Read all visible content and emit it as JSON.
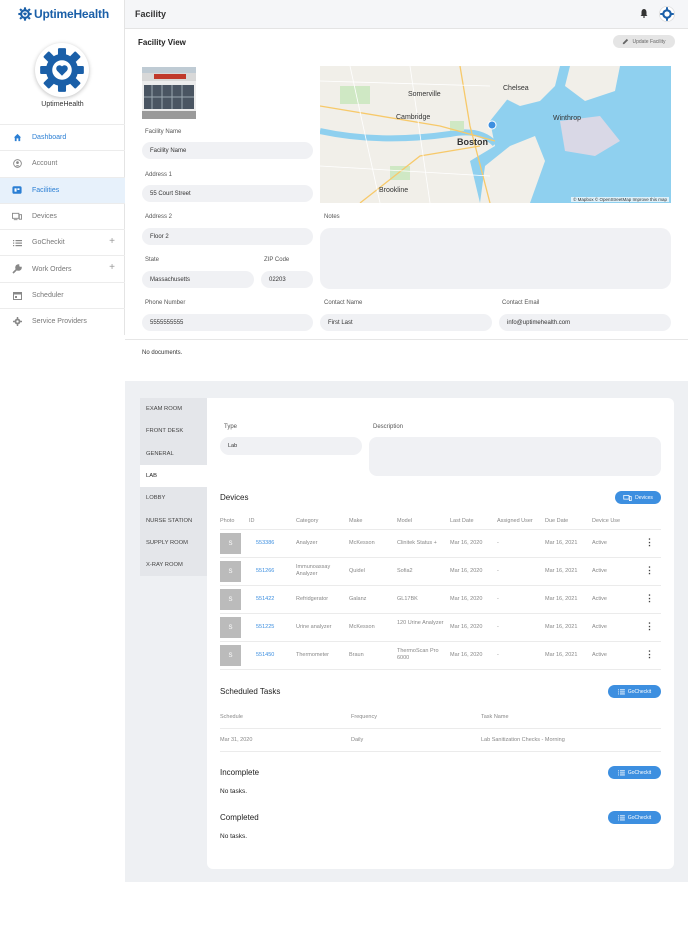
{
  "app": {
    "brand": "UptimeHealth",
    "org_name": "UptimeHealth"
  },
  "sidebar": {
    "items": [
      {
        "label": "Dashboard",
        "icon": "home-icon",
        "active": false
      },
      {
        "label": "Account",
        "icon": "account-icon",
        "active": false
      },
      {
        "label": "Facilities",
        "icon": "facilities-icon",
        "active": true
      },
      {
        "label": "Devices",
        "icon": "devices-icon",
        "active": false
      },
      {
        "label": "GoCheckit",
        "icon": "list-icon",
        "expandable": true
      },
      {
        "label": "Work Orders",
        "icon": "wrench-icon",
        "expandable": true
      },
      {
        "label": "Scheduler",
        "icon": "calendar-icon"
      },
      {
        "label": "Service Providers",
        "icon": "gear-icon"
      }
    ]
  },
  "header": {
    "title": "Facility"
  },
  "facility": {
    "view_title": "Facility View",
    "update_button": "Update Facility",
    "map_attribution": "© Mapbox © OpenStreetMap  Improve this map",
    "map_labels": [
      "Somerville",
      "Chelsea",
      "Cambridge",
      "Winthrop",
      "Boston",
      "Brookline"
    ],
    "fields": {
      "facility_name": {
        "label": "Facility Name",
        "value": "Facility Name"
      },
      "address1": {
        "label": "Address 1",
        "value": "55 Court Street"
      },
      "address2": {
        "label": "Address 2",
        "value": "Floor 2"
      },
      "notes": {
        "label": "Notes",
        "value": ""
      },
      "state": {
        "label": "State",
        "value": "Massachusetts"
      },
      "zip": {
        "label": "ZIP Code",
        "value": "02203"
      },
      "phone": {
        "label": "Phone Number",
        "value": "5555555555"
      },
      "contact_name": {
        "label": "Contact Name",
        "value": "First Last"
      },
      "contact_email": {
        "label": "Contact Email",
        "value": "info@uptimehealth.com"
      }
    },
    "no_documents": "No documents."
  },
  "rooms": {
    "tabs": [
      "EXAM ROOM",
      "FRONT DESK",
      "GENERAL",
      "LAB",
      "LOBBY",
      "NURSE STATION",
      "SUPPLY ROOM",
      "X-RAY ROOM"
    ],
    "active_tab": "LAB",
    "type_label": "Type",
    "type_value": "Lab",
    "description_label": "Description",
    "description_value": ""
  },
  "devices": {
    "title": "Devices",
    "button": "Devices",
    "columns": [
      "Photo",
      "ID",
      "Category",
      "Make",
      "Model",
      "Last Date",
      "Assigned User",
      "Due Date",
      "Device Use"
    ],
    "rows": [
      {
        "photo": "S",
        "id": "553386",
        "category": "Analyzer",
        "make": "McKesson",
        "model": "Clinitek Status +",
        "last": "Mar 16, 2020",
        "user": "-",
        "due": "Mar 16, 2021",
        "use": "Active"
      },
      {
        "photo": "S",
        "id": "551266",
        "category": "Immunoassay Analyzer",
        "make": "Quidel",
        "model": "Sofia2",
        "last": "Mar 16, 2020",
        "user": "-",
        "due": "Mar 16, 2021",
        "use": "Active"
      },
      {
        "photo": "S",
        "id": "551422",
        "category": "Refridgerator",
        "make": "Galanz",
        "model": "GL17BK",
        "last": "Mar 16, 2020",
        "user": "-",
        "due": "Mar 16, 2021",
        "use": "Active"
      },
      {
        "photo": "S",
        "id": "551225",
        "category": "Urine analyzer",
        "make": "McKesson",
        "model": "120 Urine Analyzer",
        "last": "Mar 16, 2020",
        "user": "-",
        "due": "Mar 16, 2021",
        "use": "Active"
      },
      {
        "photo": "S",
        "id": "551450",
        "category": "Thermometer",
        "make": "Braun",
        "model": "ThermoScan Pro 6000",
        "last": "Mar 16, 2020",
        "user": "-",
        "due": "Mar 16, 2021",
        "use": "Active"
      }
    ]
  },
  "scheduled": {
    "title": "Scheduled Tasks",
    "button": "GoCheckit",
    "columns": [
      "Schedule",
      "Frequency",
      "Task Name"
    ],
    "rows": [
      {
        "schedule": "Mar 31, 2020",
        "frequency": "Daily",
        "task": "Lab Sanitization Checks - Morning"
      }
    ]
  },
  "incomplete": {
    "title": "Incomplete",
    "button": "GoCheckit",
    "empty": "No tasks."
  },
  "completed": {
    "title": "Completed",
    "button": "GoCheckit",
    "empty": "No tasks."
  },
  "colors": {
    "brand": "#1a5fa8",
    "accent": "#3d8fe0",
    "active_bg": "#e7f1fb"
  }
}
